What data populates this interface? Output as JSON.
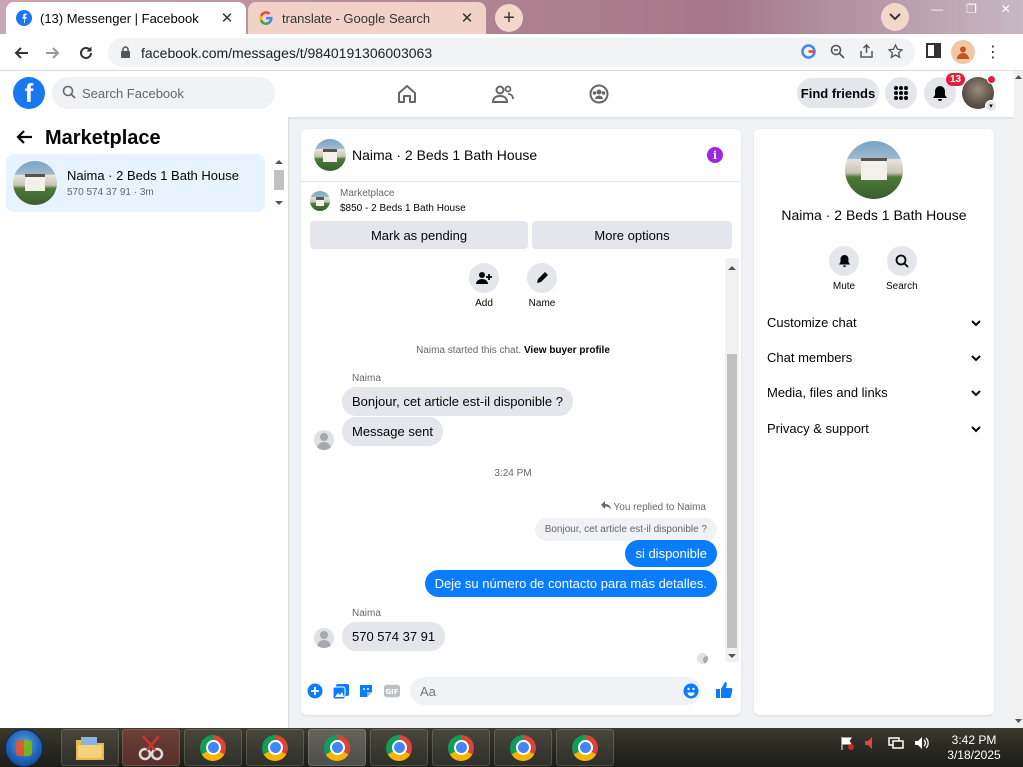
{
  "browser": {
    "tabs": [
      {
        "title": "(13) Messenger | Facebook",
        "active": true
      },
      {
        "title": "translate - Google Search",
        "active": false
      }
    ],
    "url": "facebook.com/messages/t/9840191306003063"
  },
  "fb_nav": {
    "search_placeholder": "Search Facebook",
    "find_friends": "Find friends",
    "notification_count": "13"
  },
  "sidebar": {
    "title": "Marketplace",
    "conversations": [
      {
        "name": "Naima · 2 Beds 1 Bath House",
        "preview": "570 574 37 91 · 3m"
      }
    ]
  },
  "chat": {
    "title": "Naima · 2 Beds 1 Bath House",
    "marketplace_label": "Marketplace",
    "listing": "$850 - 2 Beds 1 Bath House",
    "mark_pending": "Mark as pending",
    "more_options": "More options",
    "actions": {
      "add": "Add",
      "name": "Name"
    },
    "started_text": "Naima started this chat.",
    "view_profile": "View buyer profile",
    "messages": {
      "sender1": "Naima",
      "in1": "Bonjour, cet article est-il disponible ?",
      "in2": "Message sent",
      "timestamp": "3:24 PM",
      "reply_label": "You replied to Naima",
      "quote": "Bonjour, cet article est-il disponible ?",
      "out1": "si disponible",
      "out2": "Deje su número de contacto para más detalles.",
      "sender2": "Naima",
      "in3": "570 574 37 91"
    },
    "composer_placeholder": "Aa"
  },
  "right_panel": {
    "name": "Naima · 2 Beds 1 Bath House",
    "mute": "Mute",
    "search": "Search",
    "sections": [
      "Customize chat",
      "Chat members",
      "Media, files and links",
      "Privacy & support"
    ]
  },
  "taskbar": {
    "time": "3:42 PM",
    "date": "3/18/2025"
  },
  "colors": {
    "fb_blue": "#1877f2",
    "message_blue": "#0a7cff",
    "info_purple": "#9b25e8",
    "selected_bg": "#e7f3ff"
  }
}
